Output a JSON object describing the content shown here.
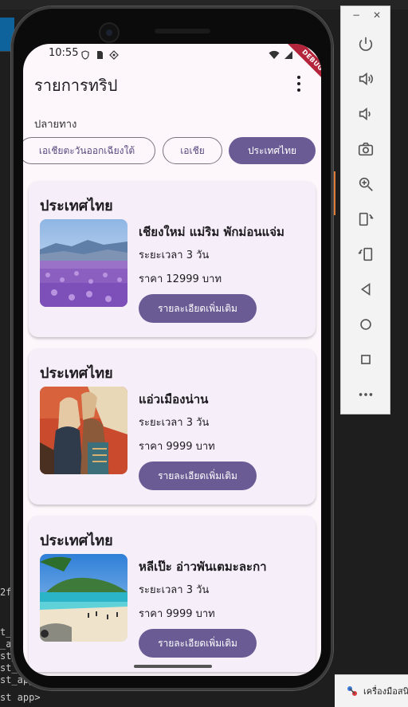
{
  "app": {
    "title": "รายการทริป",
    "status_time": "10:55",
    "debug_label": "DEBUG"
  },
  "filter": {
    "label": "ปลายทาง",
    "chips": [
      {
        "label": "เอเชียตะวันออกเฉียงใต้",
        "selected": false
      },
      {
        "label": "เอเชีย",
        "selected": false
      },
      {
        "label": "ประเทศไทย",
        "selected": true
      }
    ]
  },
  "trips": [
    {
      "country": "ประเทศไทย",
      "name": "เชียงใหม่ แม่ริม พักม่อนแจ่ม",
      "duration": "ระยะเวลา 3 วัน",
      "price": "ราคา 12999 บาท",
      "button": "รายละเอียดเพิ่มเติม",
      "image": "lavender-field-mountain"
    },
    {
      "country": "ประเทศไทย",
      "name": "แอ่วเมืองน่าน",
      "duration": "ระยะเวลา 3 วัน",
      "price": "ราคา 9999 บาท",
      "button": "รายละเอียดเพิ่มเติม",
      "image": "nan-mural-painting"
    },
    {
      "country": "ประเทศไทย",
      "name": "หลีเป๊ะ อ่าวพันเตมะละกา",
      "duration": "ระยะเวลา 3 วัน",
      "price": "ราคา 9999 บาท",
      "button": "รายละเอียดเพิ่มเติม",
      "image": "tropical-beach-island"
    }
  ],
  "emulator_toolbar": [
    "power-icon",
    "volume-up-icon",
    "volume-down-icon",
    "camera-icon",
    "zoom-in-icon",
    "rotate-left-icon",
    "rotate-right-icon",
    "back-icon",
    "home-icon",
    "overview-icon",
    "more-icon"
  ],
  "taskbar": {
    "label": "เครื่องมือสนิ"
  },
  "console_lines": [
    "2f",
    "t_",
    "_ap",
    "st_",
    "st_ap",
    "st_app",
    "st app>"
  ],
  "colors": {
    "primary": "#6b5b95",
    "surface": "#fdf7fc",
    "card": "#f6eef8"
  }
}
